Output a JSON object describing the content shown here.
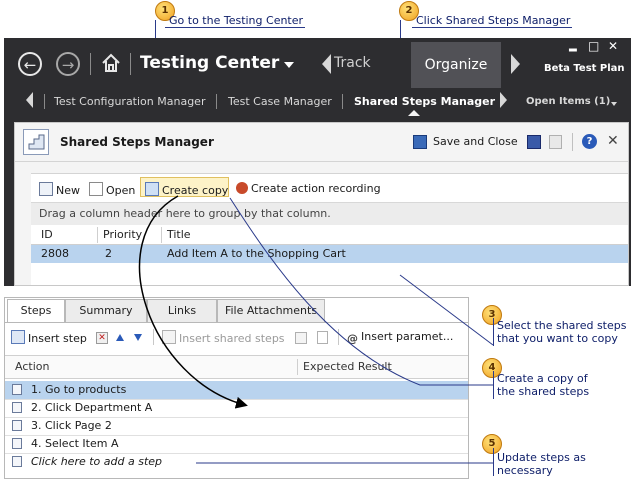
{
  "callouts": [
    {
      "num": "1",
      "text": "Go to the Testing Center"
    },
    {
      "num": "2",
      "text": "Click Shared Steps Manager"
    },
    {
      "num": "3",
      "line1": "Select the shared steps",
      "line2": "that you want to copy"
    },
    {
      "num": "4",
      "line1": "Create a copy of",
      "line2": "the shared steps"
    },
    {
      "num": "5",
      "line1": "Update steps as",
      "line2": "necessary"
    }
  ],
  "titlebar": {
    "app_title": "Testing Center",
    "track": "Track",
    "organize": "Organize",
    "plan": "Beta Test Plan",
    "minimize": "▂",
    "maximize": "□",
    "close": "✕"
  },
  "subnav": {
    "items": [
      "Test Configuration Manager",
      "Test Case Manager",
      "Shared Steps Manager"
    ],
    "open_items": "Open Items (1)"
  },
  "panel": {
    "title": "Shared Steps Manager",
    "save_close": "Save and Close"
  },
  "toolbar": {
    "new": "New",
    "open": "Open",
    "create_copy": "Create copy",
    "create_action_recording": "Create action recording"
  },
  "group_hint": "Drag a column header here to group by that column.",
  "grid": {
    "columns": [
      "ID",
      "Priority",
      "Title"
    ],
    "rows": [
      {
        "id": "2808",
        "priority": "2",
        "title": "Add Item A to the Shopping Cart"
      }
    ]
  },
  "steps_panel": {
    "tabs": [
      "Steps",
      "Summary",
      "Links",
      "File Attachments"
    ],
    "insert_step": "Insert step",
    "insert_shared_steps": "Insert shared steps",
    "insert_parameter": "Insert paramet...",
    "col_action": "Action",
    "col_expected": "Expected Result",
    "steps": [
      "1. Go to products",
      "2. Click Department A",
      "3. Click Page 2",
      "4. Select Item A"
    ],
    "add_step": "Click here to add a step"
  },
  "colors": {
    "dark_bg": "#2d2d30",
    "selection": "#b9d3ee",
    "callout_text": "#10206a"
  }
}
